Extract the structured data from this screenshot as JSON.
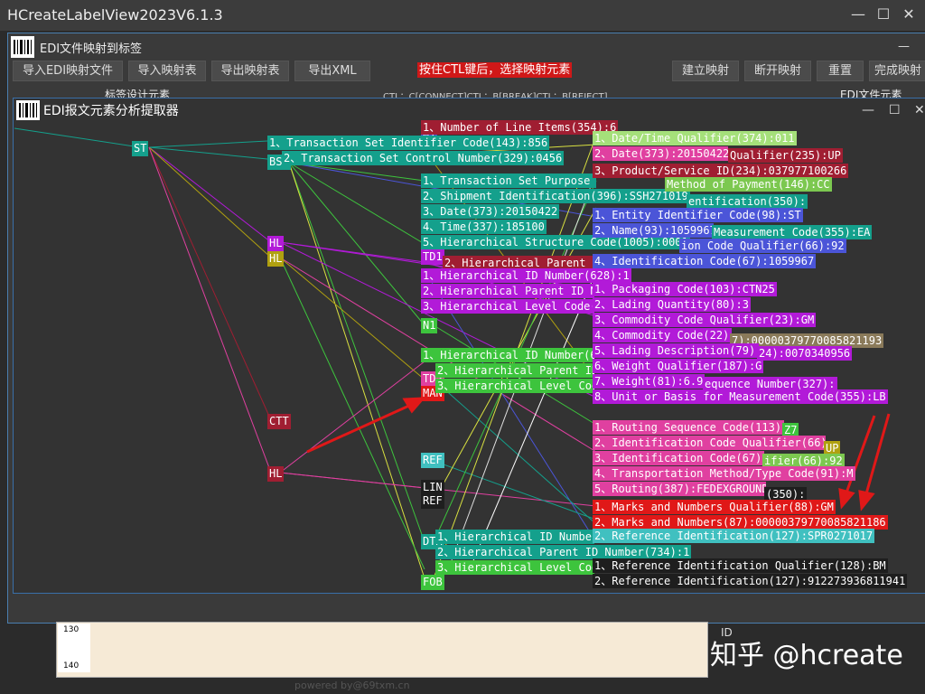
{
  "app": {
    "title": "HCreateLabelView2023V6.1.3",
    "controls": {
      "minimize": "—",
      "maximize": "☐",
      "close": "✕"
    }
  },
  "outer_window": {
    "title": "EDI文件映射到标签",
    "toolbar": {
      "import_edi": "导入EDI映射文件",
      "import_map": "导入映射表",
      "export_map": "导出映射表",
      "export_xml": "导出XML",
      "hint": "按住CTL键后，选择映射元素",
      "build_map": "建立映射",
      "break_map": "断开映射",
      "reset": "重置",
      "finish_map": "完成映射"
    },
    "partial_labels": {
      "left": "标签设计元素",
      "mid": "CTL：C[CONNECT]CTL：B[BREAK]CTL：B[REJECT]",
      "right": "EDI文件元素"
    }
  },
  "inner_window": {
    "title": "EDI报文元素分析提取器",
    "controls": {
      "minimize": "—",
      "maximize": "☐",
      "close": "✕"
    }
  },
  "segments": {
    "ST": "ST",
    "HL1": "HL",
    "HL2": "HL",
    "CTT": "CTT",
    "HL3": "HL",
    "N1": "N1",
    "BSN": "BSN",
    "TD1": "TD1",
    "N1b": "N1",
    "TD5": "TD5",
    "MAN": "MAN",
    "REF": "REF",
    "LIN": "LIN",
    "REFb": "REF",
    "DTM": "DTM",
    "FOB": "FOB"
  },
  "nodes": {
    "st1": "1、Transaction Set Identifier Code(143):856",
    "st2": "2、Transaction Set Control Number(329):0456",
    "n1_line": "1、Number of Line Items(354):6",
    "bsn1": "1、Transaction Set Purpose Code(353):00",
    "bsn2": "2、Shipment Identification(396):SSH271019",
    "bsn3": "3、Date(373):20150422",
    "bsn4": "4、Time(337):185100",
    "bsn5": "5、Hierarchical Structure Code(1005):0001",
    "hl_a": "2、Hierarchical Parent ID N",
    "hl_b1": "1、Hierarchical ID Number(628):1",
    "hl_b2": "2、Hierarchical Parent ID N",
    "hl_b3": "3、Hierarchical Level Code(",
    "hl_c1": "1、Hierarchical ID Number(6",
    "hl_c2": "2、Hierarchical Parent ID N",
    "hl_c3": "3、Hierarchical Level Code(",
    "hl_d1": "1、Hierarchical ID Number(6",
    "hl_d2": "2、Hierarchical Parent ID Number(734):1",
    "hl_d3": "3、Hierarchical Level Code(",
    "dtm1": "1、Date/Time Qualifier(374):011",
    "dtm2": "2、Date(373):20150422",
    "lin_q": "Qualifier(235):UP",
    "lin3": "3、Product/Service ID(234):037977100266",
    "fob1": "Method of Payment(146):CC",
    "ref_id": "entification(350):",
    "n1_1": "1、Entity Identifier Code(98):ST",
    "n1_2": "2、Name(93):1059967",
    "n1_m": "Measurement Code(355):EA",
    "n1_3": "ion Code Qualifier(66):92",
    "n1_4": "4、Identification Code(67):1059967",
    "td1_1": "1、Packaging Code(103):CTN25",
    "td1_2": "2、Lading Quantity(80):3",
    "td1_3": "3、Commodity Code Qualifier(23):GM",
    "td1_4": "4、Commodity Code(22):",
    "td1_4b": "7):00000379770085821193",
    "td1_5": "5、Lading Description(79):",
    "td1_5b": "24):0070340956",
    "td1_6": "6、Weight Qualifier(187):G",
    "td1_7": "7、Weight(81):6.9",
    "td1_7b": "equence Number(327):",
    "td1_8": "8、Unit or Basis for Measurement Code(355):LB",
    "td5_1": "1、Routing Sequence Code(113):",
    "td5_1b": "Z7",
    "td5_2": "2、Identification Code Qualifier(66):",
    "td5_2b": "UP",
    "td5_3": "3、Identification Code(67):",
    "td5_3b": "ifier(66):92",
    "td5_4": "4、Transportation Method/Type Code(91):M",
    "td5_5": "5、Routing(387):FEDEXGROUND",
    "td5_5b": "(350):",
    "man1": "1、Marks and Numbers Qualifier(88):GM",
    "man2": "2、Marks and Numbers(87):00000379770085821186",
    "man3": "2、Reference Identification(127):SPR0271017",
    "ref1": "1、Reference Identification Qualifier(128):BM",
    "ref2": "2、Reference Identification(127):912273936811941"
  },
  "bottom": {
    "ruler_130": "130",
    "ruler_140": "140",
    "credit": "powered by@69txm.cn",
    "id_label": "ID",
    "watermark": "知乎 @hcreate"
  },
  "colors": {
    "teal": "#14a08c",
    "maroon": "#a01e32",
    "purple": "#b21ad8",
    "green": "#3dc43d",
    "blue": "#4b55d8",
    "pink": "#e040a0",
    "red": "#e01818",
    "olive": "#b0a010",
    "dark": "#1e1e1e"
  }
}
